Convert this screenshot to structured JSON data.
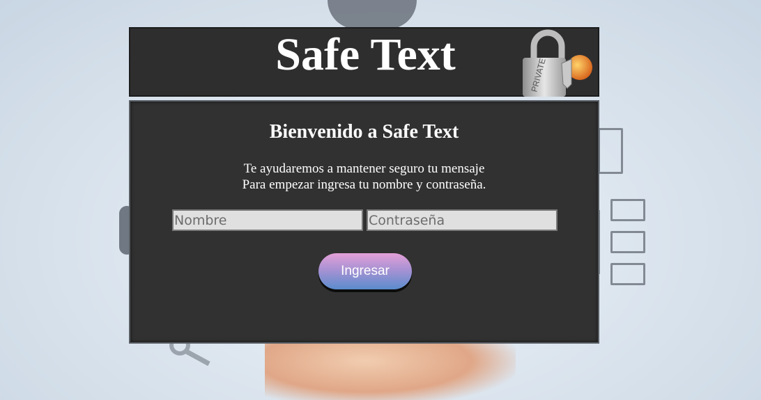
{
  "header": {
    "title": "Safe Text",
    "lock_icon": "padlock-icon",
    "lock_label": "PRIVATE"
  },
  "panel": {
    "welcome": "Bienvenido a Safe Text",
    "line1": "Te ayudaremos a mantener seguro tu mensaje",
    "line2": "Para empezar ingresa tu nombre y contraseña."
  },
  "form": {
    "name_placeholder": "Nombre",
    "name_value": "",
    "password_placeholder": "Contraseña",
    "password_value": "",
    "submit_label": "Ingresar"
  },
  "colors": {
    "header_bg": "#2f2e2f",
    "panel_bg": "#313131",
    "button_top": "#e4a0d8",
    "button_bottom": "#5a8ccd"
  }
}
